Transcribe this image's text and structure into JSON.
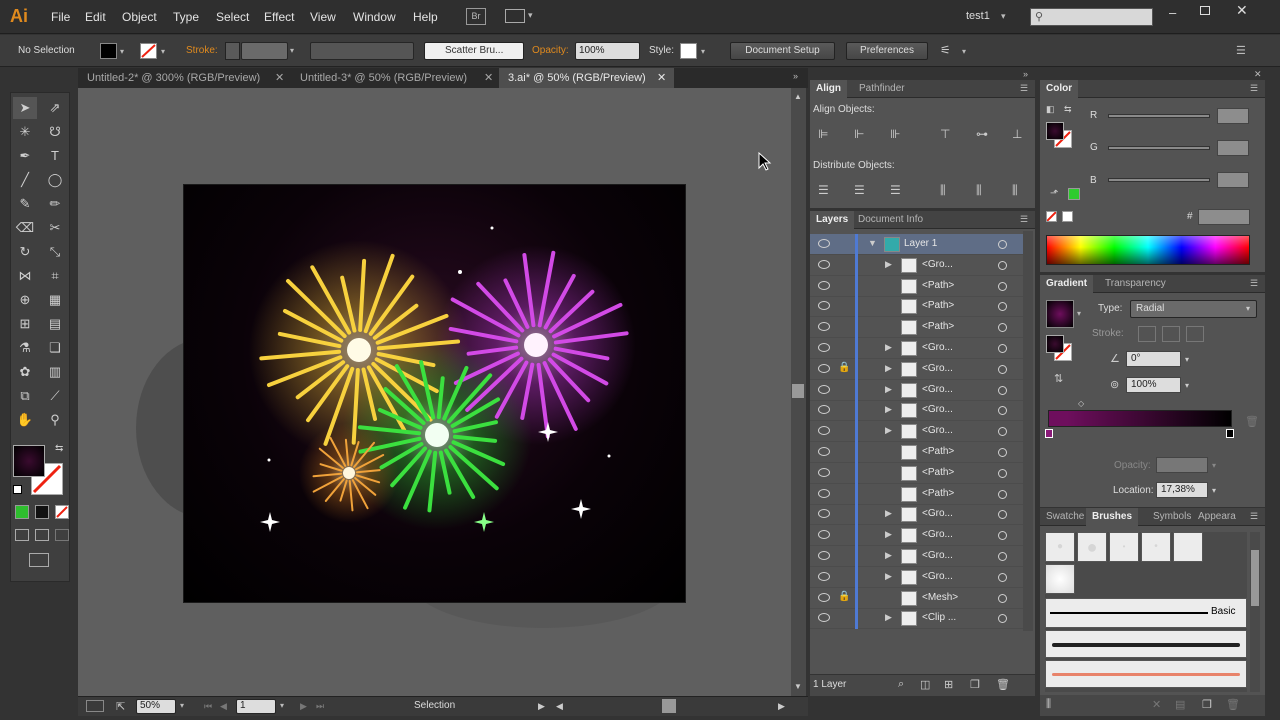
{
  "menubar": {
    "logo": "Ai",
    "items": [
      "File",
      "Edit",
      "Object",
      "Type",
      "Select",
      "Effect",
      "View",
      "Window",
      "Help"
    ],
    "bridge_label": "Br",
    "workspace": "test1",
    "window_controls": [
      "minimize-icon",
      "restore-icon",
      "close-icon"
    ]
  },
  "control_bar": {
    "selection_label": "No Selection",
    "stroke_label": "Stroke:",
    "brush_label": "Scatter Bru...",
    "opacity_label": "Opacity:",
    "opacity_value": "100%",
    "style_label": "Style:",
    "document_setup": "Document Setup",
    "preferences": "Preferences"
  },
  "tabs": [
    {
      "label": "Untitled-2* @ 300% (RGB/Preview)",
      "active": false
    },
    {
      "label": "Untitled-3* @ 50% (RGB/Preview)",
      "active": false
    },
    {
      "label": "3.ai* @ 50% (RGB/Preview)",
      "active": true
    }
  ],
  "status": {
    "zoom": "50%",
    "page": "1",
    "tool": "Selection"
  },
  "align_panel": {
    "tabs": [
      "Align",
      "Pathfinder"
    ],
    "align_objects": "Align Objects:",
    "distribute_objects": "Distribute Objects:"
  },
  "layers_panel": {
    "tabs": [
      "Layers",
      "Document Info"
    ],
    "rows": [
      {
        "label": "Layer 1",
        "expand": true,
        "lock": false,
        "indent": 0
      },
      {
        "label": "<Gro...",
        "expand": true,
        "lock": false,
        "indent": 1
      },
      {
        "label": "<Path>",
        "expand": false,
        "lock": false,
        "indent": 1
      },
      {
        "label": "<Path>",
        "expand": false,
        "lock": false,
        "indent": 1
      },
      {
        "label": "<Path>",
        "expand": false,
        "lock": false,
        "indent": 1
      },
      {
        "label": "<Gro...",
        "expand": true,
        "lock": false,
        "indent": 1
      },
      {
        "label": "<Gro...",
        "expand": true,
        "lock": true,
        "indent": 1
      },
      {
        "label": "<Gro...",
        "expand": true,
        "lock": false,
        "indent": 1
      },
      {
        "label": "<Gro...",
        "expand": true,
        "lock": false,
        "indent": 1
      },
      {
        "label": "<Gro...",
        "expand": true,
        "lock": false,
        "indent": 1
      },
      {
        "label": "<Path>",
        "expand": false,
        "lock": false,
        "indent": 1
      },
      {
        "label": "<Path>",
        "expand": false,
        "lock": false,
        "indent": 1
      },
      {
        "label": "<Path>",
        "expand": false,
        "lock": false,
        "indent": 1
      },
      {
        "label": "<Gro...",
        "expand": true,
        "lock": false,
        "indent": 1
      },
      {
        "label": "<Gro...",
        "expand": true,
        "lock": false,
        "indent": 1
      },
      {
        "label": "<Gro...",
        "expand": true,
        "lock": false,
        "indent": 1
      },
      {
        "label": "<Gro...",
        "expand": true,
        "lock": false,
        "indent": 1
      },
      {
        "label": "<Mesh>",
        "expand": false,
        "lock": true,
        "indent": 1
      },
      {
        "label": "<Clip ...",
        "expand": true,
        "lock": false,
        "indent": 1
      }
    ],
    "footer": "1 Layer"
  },
  "color_panel": {
    "tab": "Color",
    "channels": [
      "R",
      "G",
      "B"
    ],
    "hex_label": "#"
  },
  "gradient_panel": {
    "tabs": [
      "Gradient",
      "Transparency"
    ],
    "type_label": "Type:",
    "type_value": "Radial",
    "stroke_label": "Stroke:",
    "angle_value": "0°",
    "aspect_value": "100%",
    "opacity_label": "Opacity:",
    "location_label": "Location:",
    "location_value": "17,38%"
  },
  "brushes_panel": {
    "tabs": [
      "Swatche",
      "Brushes",
      "Symbols",
      "Appeara"
    ],
    "basic_label": "Basic"
  },
  "colors": {
    "accent": "#e08a1e",
    "layer_bar": "#4f7ad3",
    "highlight_row": "#5f6d86"
  }
}
